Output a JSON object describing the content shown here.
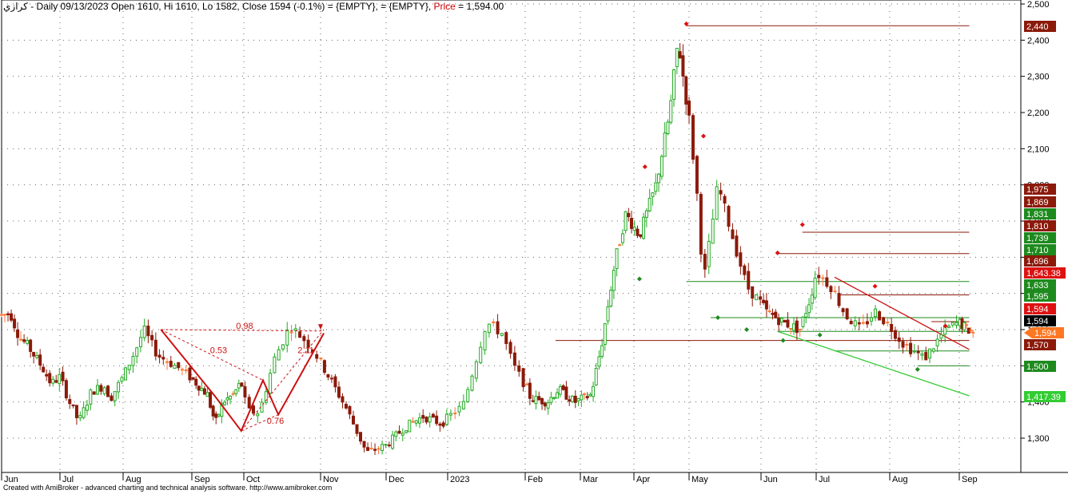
{
  "header": {
    "symbol": "كرازي",
    "info": " - Daily 09/13/2023 Open 1610, Hi 1610, Lo 1582, Close 1594 (-0.1%)   = {EMPTY},   = {EMPTY}, ",
    "price_key": "Price",
    "price_value": " = 1,594.00"
  },
  "footer": "Created with AmiBroker - advanced charting and technical analysis software. http://www.amibroker.com",
  "colors": {
    "up": "#22aa22",
    "down": "#8b1a0a",
    "doji": "#ff7733",
    "resistance": "#8b1a0a",
    "support": "#1e8a1e",
    "trend_down": "#cc1111",
    "trend_up": "#33cc33",
    "pattern": "#cc1111",
    "current_price": "#000000",
    "last_price_marker": "#ff7722"
  },
  "chart_data": {
    "type": "candlestick",
    "x_axis_labels": [
      "Jun",
      "Jul",
      "Aug",
      "Sep",
      "Oct",
      "Nov",
      "Dec",
      "2023",
      "Feb",
      "Mar",
      "Apr",
      "May",
      "Jun",
      "Jul",
      "Aug",
      "Sep"
    ],
    "y_ticks": [
      "2,500",
      "2,400",
      "2,300",
      "2,200",
      "2,100",
      "2,000",
      "1,900",
      "1,800",
      "1,700",
      "1,600",
      "1,500",
      "1,400",
      "1,300"
    ],
    "ylim": [
      1220,
      2505
    ],
    "grid": true,
    "price_tags": [
      {
        "label": "2,440",
        "value": 2440,
        "color": "#8b1a0a"
      },
      {
        "label": "1,975",
        "value": 1975,
        "color": "#8b1a0a"
      },
      {
        "label": "1,869",
        "value": 1869,
        "color": "#8b1a0a"
      },
      {
        "label": "1,831",
        "value": 1831,
        "color": "#1e8a1e"
      },
      {
        "label": "1,810",
        "value": 1810,
        "color": "#8b1a0a"
      },
      {
        "label": "1,739",
        "value": 1739,
        "color": "#1e8a1e"
      },
      {
        "label": "1,710",
        "value": 1710,
        "color": "#1e8a1e"
      },
      {
        "label": "1,696",
        "value": 1696,
        "color": "#8b1a0a"
      },
      {
        "label": "1,643.38",
        "value": 1643.38,
        "color": "#dd1111"
      },
      {
        "label": "1,633",
        "value": 1633,
        "color": "#1e8a1e"
      },
      {
        "label": "1,595",
        "value": 1595,
        "color": "#1e8a1e"
      },
      {
        "label": "1,594",
        "value": 1594,
        "color": "#dd1111"
      },
      {
        "label": "1,594",
        "value": 1594,
        "color": "#000000"
      },
      {
        "label": "1,594",
        "value": 1594,
        "color": "#ff7722"
      },
      {
        "label": "1,570",
        "value": 1570,
        "color": "#8b1a0a"
      },
      {
        "label": "1,500",
        "value": 1500,
        "color": "#1e8a1e"
      },
      {
        "label": "1,417.39",
        "value": 1417.39,
        "color": "#33cc33"
      }
    ],
    "pattern_labels": [
      "0.98",
      "0.53",
      "2.11",
      "0.76"
    ],
    "resistance_lines": [
      2440,
      1869,
      1810,
      1696,
      1622,
      1570
    ],
    "support_lines": [
      1733,
      1633,
      1500,
      1541,
      1573
    ],
    "anchors": [
      {
        "m": 0,
        "p": 1640
      },
      {
        "m": 0.15,
        "p": 1645
      },
      {
        "m": 0.3,
        "p": 1580
      },
      {
        "m": 0.45,
        "p": 1555
      },
      {
        "m": 0.7,
        "p": 1495
      },
      {
        "m": 0.85,
        "p": 1450
      },
      {
        "m": 1.0,
        "p": 1470
      },
      {
        "m": 1.15,
        "p": 1400
      },
      {
        "m": 1.3,
        "p": 1345
      },
      {
        "m": 1.5,
        "p": 1430
      },
      {
        "m": 1.7,
        "p": 1445
      },
      {
        "m": 1.8,
        "p": 1410
      },
      {
        "m": 2.0,
        "p": 1470
      },
      {
        "m": 2.2,
        "p": 1552
      },
      {
        "m": 2.3,
        "p": 1600
      },
      {
        "m": 2.5,
        "p": 1530
      },
      {
        "m": 2.8,
        "p": 1495
      },
      {
        "m": 3.0,
        "p": 1465
      },
      {
        "m": 3.3,
        "p": 1420
      },
      {
        "m": 3.45,
        "p": 1340
      },
      {
        "m": 3.6,
        "p": 1400
      },
      {
        "m": 3.8,
        "p": 1420
      },
      {
        "m": 3.95,
        "p": 1455
      },
      {
        "m": 4.05,
        "p": 1375
      },
      {
        "m": 4.2,
        "p": 1370
      },
      {
        "m": 4.4,
        "p": 1520
      },
      {
        "m": 4.6,
        "p": 1610
      },
      {
        "m": 4.75,
        "p": 1580
      },
      {
        "m": 4.85,
        "p": 1560
      },
      {
        "m": 5.4,
        "p": 1380
      },
      {
        "m": 5.7,
        "p": 1260
      },
      {
        "m": 6.0,
        "p": 1280
      },
      {
        "m": 6.3,
        "p": 1330
      },
      {
        "m": 6.6,
        "p": 1360
      },
      {
        "m": 6.9,
        "p": 1340
      },
      {
        "m": 7.2,
        "p": 1390
      },
      {
        "m": 7.5,
        "p": 1620
      },
      {
        "m": 7.7,
        "p": 1590
      },
      {
        "m": 7.85,
        "p": 1500
      },
      {
        "m": 8.1,
        "p": 1410
      },
      {
        "m": 8.4,
        "p": 1400
      },
      {
        "m": 8.6,
        "p": 1435
      },
      {
        "m": 8.9,
        "p": 1400
      },
      {
        "m": 9.2,
        "p": 1420
      },
      {
        "m": 9.4,
        "p": 1560
      },
      {
        "m": 9.65,
        "p": 1790
      },
      {
        "m": 9.85,
        "p": 1920
      },
      {
        "m": 10.1,
        "p": 1860
      },
      {
        "m": 10.4,
        "p": 2000
      },
      {
        "m": 10.65,
        "p": 2200
      },
      {
        "m": 10.8,
        "p": 2400
      },
      {
        "m": 11.0,
        "p": 2180
      },
      {
        "m": 11.1,
        "p": 2000
      },
      {
        "m": 11.2,
        "p": 1730
      },
      {
        "m": 11.4,
        "p": 2000
      },
      {
        "m": 11.6,
        "p": 1860
      },
      {
        "m": 11.8,
        "p": 1720
      },
      {
        "m": 12.1,
        "p": 1650
      },
      {
        "m": 12.4,
        "p": 1620
      },
      {
        "m": 12.7,
        "p": 1600
      },
      {
        "m": 12.9,
        "p": 1690
      },
      {
        "m": 13.0,
        "p": 1760
      },
      {
        "m": 13.2,
        "p": 1720
      },
      {
        "m": 13.4,
        "p": 1640
      },
      {
        "m": 13.6,
        "p": 1600
      },
      {
        "m": 13.8,
        "p": 1650
      },
      {
        "m": 14.0,
        "p": 1610
      },
      {
        "m": 14.2,
        "p": 1560
      },
      {
        "m": 14.5,
        "p": 1520
      },
      {
        "m": 14.8,
        "p": 1600
      },
      {
        "m": 15.0,
        "p": 1620
      },
      {
        "m": 15.2,
        "p": 1600
      },
      {
        "m": 15.35,
        "p": 1594
      }
    ]
  }
}
